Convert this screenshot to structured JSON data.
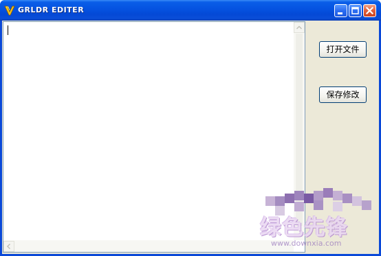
{
  "window": {
    "title": "GRLDR EDITER",
    "icon": "app-v-icon",
    "controls": [
      "minimize-icon",
      "maximize-icon",
      "close-icon"
    ]
  },
  "editor": {
    "value": "",
    "vertical_scrollbar": true,
    "horizontal_scrollbar": true
  },
  "buttons": {
    "open_file": "打开文件",
    "save_changes": "保存修改"
  },
  "watermark": {
    "text": "绿色先锋",
    "url": "www.downxia.com"
  },
  "colors": {
    "titlebar": "#0552e0",
    "client_bg": "#ece9d8",
    "close_button": "#e4623e",
    "watermark": "#b48ccf"
  }
}
